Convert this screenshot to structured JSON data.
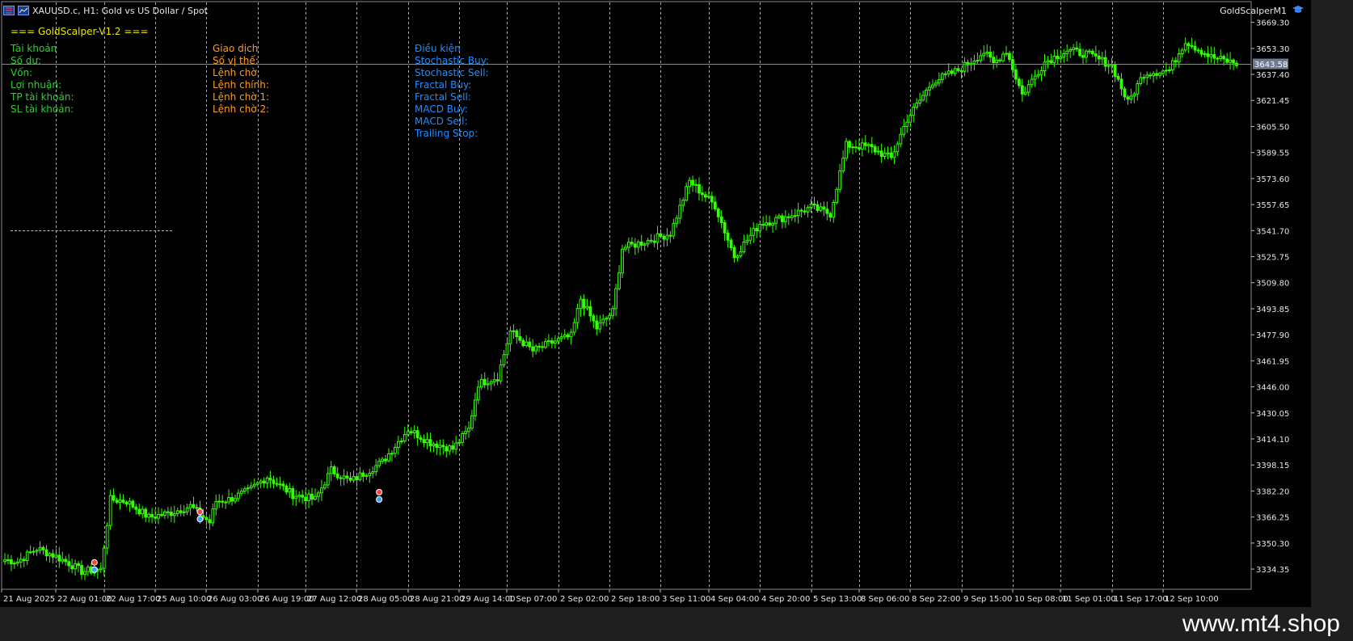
{
  "window": {
    "title": "XAUUSD.c, H1:  Gold vs US Dollar / Spot",
    "ea_name": "GoldScalperM1",
    "ea_icon": "graduation-cap-icon",
    "menu_icon": "chart-window-icon"
  },
  "panel": {
    "title": "=== GoldScalper-V1.2 ===",
    "account": [
      "Tài khoản",
      "Số dư:",
      "Vốn:",
      "Lợi nhuận:",
      "TP tài khoản:",
      "SL tài khoản:"
    ],
    "trade": [
      "Giao dịch",
      "Số vị thế:",
      "Lệnh chờ:",
      "Lệnh chính:",
      "Lệnh chờ 1:",
      "Lệnh chờ 2:"
    ],
    "conditions": [
      "Điều kiện",
      "Stochastic Buy:",
      "Stochastic Sell:",
      "Fractal Buy:",
      "Fractal Sell:",
      "MACD Buy:",
      "MACD Sell:",
      "Trailing Stop:"
    ]
  },
  "watermark": "www.mt4.shop",
  "colors": {
    "background": "#000000",
    "bull_candle": "#33ff00",
    "axis_text": "#e6e6e6",
    "bid_line": "#7a8aa6",
    "price_label_bg": "#6d7a94",
    "grid": "#c8c8c8"
  },
  "chart_data": {
    "type": "candlestick",
    "symbol": "XAUUSD.c",
    "timeframe": "H1",
    "ylim": [
      3322,
      3680
    ],
    "y_ticks": [
      "3669.30",
      "3653.30",
      "3637.40",
      "3621.45",
      "3605.50",
      "3589.55",
      "3573.60",
      "3557.65",
      "3541.70",
      "3525.75",
      "3509.80",
      "3493.85",
      "3477.90",
      "3461.95",
      "3446.00",
      "3430.05",
      "3414.10",
      "3398.15",
      "3382.20",
      "3366.25",
      "3350.30",
      "3334.35"
    ],
    "x_ticks": [
      "21 Aug 2025",
      "22 Aug 01:00",
      "22 Aug 17:00",
      "25 Aug 10:00",
      "26 Aug 03:00",
      "26 Aug 19:00",
      "27 Aug 12:00",
      "28 Aug 05:00",
      "28 Aug 21:00",
      "29 Aug 14:00",
      "1 Sep 07:00",
      "2 Sep 02:00",
      "2 Sep 18:00",
      "3 Sep 11:00",
      "4 Sep 04:00",
      "4 Sep 20:00",
      "5 Sep 13:00",
      "8 Sep 06:00",
      "8 Sep 22:00",
      "9 Sep 15:00",
      "10 Sep 08:00",
      "11 Sep 01:00",
      "11 Sep 17:00",
      "12 Sep 10:00"
    ],
    "current_price": "3643.58",
    "current_price_value": 3643.58,
    "grid": true,
    "close_path": [
      [
        0,
        3340
      ],
      [
        4,
        3339
      ],
      [
        10,
        3347
      ],
      [
        15,
        3343
      ],
      [
        20,
        3338
      ],
      [
        24,
        3333
      ],
      [
        30,
        3334
      ],
      [
        33,
        3377
      ],
      [
        38,
        3376
      ],
      [
        45,
        3366
      ],
      [
        52,
        3369
      ],
      [
        58,
        3373
      ],
      [
        64,
        3363
      ],
      [
        66,
        3376
      ],
      [
        70,
        3377
      ],
      [
        76,
        3382
      ],
      [
        82,
        3391
      ],
      [
        90,
        3380
      ],
      [
        97,
        3377
      ],
      [
        102,
        3395
      ],
      [
        108,
        3388
      ],
      [
        118,
        3400
      ],
      [
        126,
        3420
      ],
      [
        133,
        3412
      ],
      [
        140,
        3408
      ],
      [
        145,
        3420
      ],
      [
        148,
        3448
      ],
      [
        154,
        3452
      ],
      [
        158,
        3480
      ],
      [
        165,
        3468
      ],
      [
        172,
        3474
      ],
      [
        177,
        3477
      ],
      [
        180,
        3500
      ],
      [
        185,
        3482
      ],
      [
        190,
        3492
      ],
      [
        193,
        3531
      ],
      [
        200,
        3535
      ],
      [
        208,
        3540
      ],
      [
        214,
        3572
      ],
      [
        222,
        3557
      ],
      [
        228,
        3526
      ],
      [
        236,
        3546
      ],
      [
        244,
        3550
      ],
      [
        252,
        3556
      ],
      [
        258,
        3552
      ],
      [
        263,
        3594
      ],
      [
        270,
        3593
      ],
      [
        277,
        3586
      ],
      [
        282,
        3610
      ],
      [
        290,
        3633
      ],
      [
        298,
        3640
      ],
      [
        306,
        3651
      ],
      [
        309,
        3644
      ],
      [
        313,
        3652
      ],
      [
        318,
        3625
      ],
      [
        325,
        3645
      ],
      [
        332,
        3652
      ],
      [
        338,
        3650
      ],
      [
        346,
        3643
      ],
      [
        351,
        3620
      ],
      [
        356,
        3638
      ],
      [
        364,
        3640
      ],
      [
        369,
        3658
      ],
      [
        377,
        3648
      ],
      [
        385,
        3644
      ]
    ],
    "markers": [
      {
        "i": 28,
        "price": 3336
      },
      {
        "i": 61,
        "price": 3367
      },
      {
        "i": 117,
        "price": 3379
      }
    ]
  }
}
